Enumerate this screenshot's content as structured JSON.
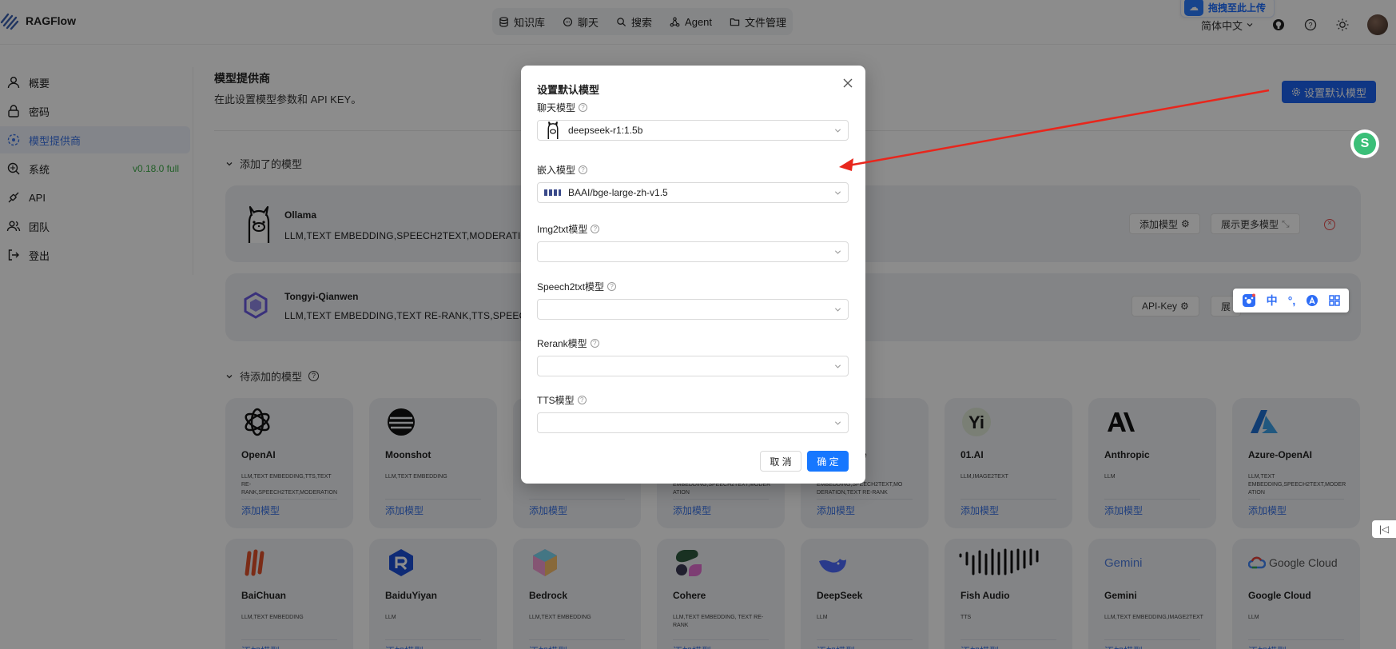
{
  "app": {
    "name": "RAGFlow"
  },
  "topnav": [
    {
      "label": "知识库",
      "icon": "database-icon"
    },
    {
      "label": "聊天",
      "icon": "chat-icon"
    },
    {
      "label": "搜索",
      "icon": "search-icon"
    },
    {
      "label": "Agent",
      "icon": "agent-icon"
    },
    {
      "label": "文件管理",
      "icon": "folder-icon"
    }
  ],
  "topright": {
    "language": "简体中文",
    "upload_badge": "拖拽至此上传"
  },
  "sidebar": {
    "items": [
      {
        "label": "概要",
        "icon": "user-icon"
      },
      {
        "label": "密码",
        "icon": "lock-icon"
      },
      {
        "label": "模型提供商",
        "icon": "model-icon",
        "active": true
      },
      {
        "label": "系统",
        "icon": "system-icon"
      },
      {
        "label": "API",
        "icon": "api-icon"
      },
      {
        "label": "团队",
        "icon": "team-icon"
      },
      {
        "label": "登出",
        "icon": "logout-icon"
      }
    ],
    "version": "v0.18.0 full"
  },
  "main": {
    "title": "模型提供商",
    "subtitle": "在此设置模型参数和 API KEY。",
    "set_default_button": "设置默认模型",
    "added_section": "添加了的模型",
    "pending_section": "待添加的模型",
    "added": [
      {
        "name": "Ollama",
        "tags": "LLM,TEXT EMBEDDING,SPEECH2TEXT,MODERATION",
        "btn1": "添加模型",
        "btn2": "展示更多模型"
      },
      {
        "name": "Tongyi-Qianwen",
        "tags": "LLM,TEXT EMBEDDING,TEXT RE-RANK,TTS,SPEECH2",
        "btn1": "API-Key",
        "btn2": "展"
      }
    ],
    "add_model_link": "添加模型",
    "providers_row1": [
      {
        "name": "OpenAI",
        "tags": "LLM,TEXT EMBEDDING,TTS,TEXT RE-RANK,SPEECH2TEXT,MODERATION"
      },
      {
        "name": "Moonshot",
        "tags": "LLM,TEXT EMBEDDING"
      },
      {
        "name": "",
        "tags": ""
      },
      {
        "name": "",
        "tags": "EMBEDDING,SPEECH2TEXT,MODER ATION"
      },
      {
        "name": "e",
        "tags": "EMBEDDING,SPEECH2TEXT,MO DERATION,TEXT RE-RANK"
      },
      {
        "name": "01.AI",
        "tags": "LLM,IMAGE2TEXT"
      },
      {
        "name": "Anthropic",
        "tags": "LLM"
      },
      {
        "name": "Azure-OpenAI",
        "tags": "LLM,TEXT EMBEDDING,SPEECH2TEXT,MODER ATION"
      }
    ],
    "providers_row2": [
      {
        "name": "BaiChuan",
        "tags": "LLM,TEXT EMBEDDING"
      },
      {
        "name": "BaiduYiyan",
        "tags": "LLM"
      },
      {
        "name": "Bedrock",
        "tags": "LLM,TEXT EMBEDDING"
      },
      {
        "name": "Cohere",
        "tags": "LLM,TEXT EMBEDDING, TEXT RE-RANK"
      },
      {
        "name": "DeepSeek",
        "tags": "LLM"
      },
      {
        "name": "Fish Audio",
        "tags": "TTS"
      },
      {
        "name": "Gemini",
        "tags": "LLM,TEXT EMBEDDING,IMAGE2TEXT"
      },
      {
        "name": "Google Cloud",
        "tags": "LLM"
      }
    ],
    "logo_text": {
      "gemini": "Gemini",
      "google_cloud": "Google Cloud"
    }
  },
  "modal": {
    "title": "设置默认模型",
    "fields": [
      {
        "label": "聊天模型",
        "value": "deepseek-r1:1.5b"
      },
      {
        "label": "嵌入模型",
        "value": "BAAI/bge-large-zh-v1.5"
      },
      {
        "label": "Img2txt模型",
        "value": ""
      },
      {
        "label": "Speech2txt模型",
        "value": ""
      },
      {
        "label": "Rerank模型",
        "value": ""
      },
      {
        "label": "TTS模型",
        "value": ""
      }
    ],
    "cancel": "取 消",
    "ok": "确 定"
  },
  "ime": {
    "lang": "中"
  },
  "colors": {
    "primary": "#1677ff",
    "accent": "#1c63f0",
    "arrow": "#e8261c",
    "version": "#3fae4a"
  }
}
